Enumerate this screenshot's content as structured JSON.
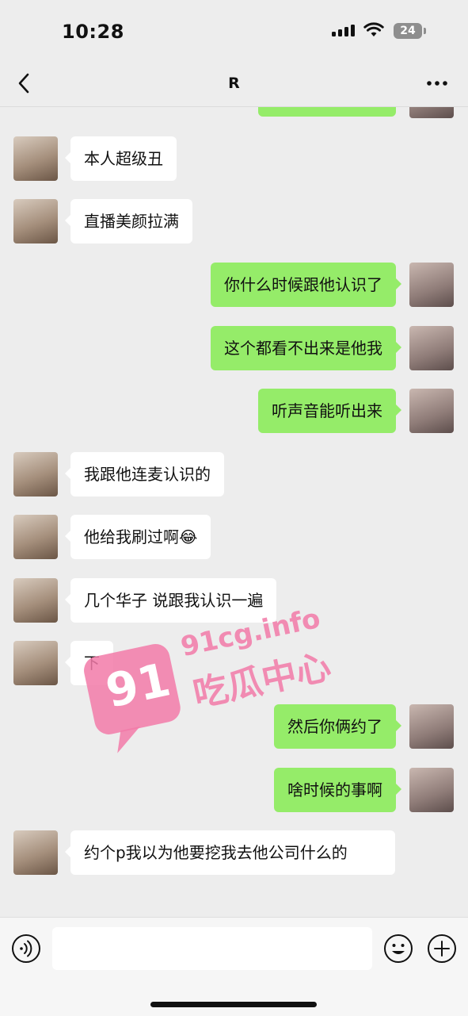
{
  "status_bar": {
    "time": "10:28",
    "battery": "24"
  },
  "header": {
    "title": "R"
  },
  "messages": [
    {
      "side": "in",
      "text": "本人超级丑"
    },
    {
      "side": "in",
      "text": "直播美颜拉满"
    },
    {
      "side": "out",
      "text": "你什么时候跟他认识了"
    },
    {
      "side": "out",
      "text": "这个都看不出来是他我"
    },
    {
      "side": "out",
      "text": "听声音能听出来"
    },
    {
      "side": "in",
      "text": "我跟他连麦认识的"
    },
    {
      "side": "in",
      "text": "他给我刷过啊",
      "emoji": "😂"
    },
    {
      "side": "in",
      "text": "几个华子 说跟我认识一遍"
    },
    {
      "side": "in",
      "text": "下"
    },
    {
      "side": "out",
      "text": "然后你俩约了"
    },
    {
      "side": "out",
      "text": "啥时候的事啊"
    },
    {
      "side": "in",
      "text": "约个p我以为他要挖我去他公司什么的"
    }
  ],
  "watermark": {
    "number": "91",
    "domain": "91cg.info",
    "name": "吃瓜中心"
  },
  "input_bar": {
    "text_value": ""
  },
  "icons": {
    "back": "chevron-left-icon",
    "more": "more-dots-icon",
    "voice": "voice-icon",
    "emoji": "smiley-icon",
    "plus": "plus-icon"
  },
  "colors": {
    "background": "#ededed",
    "outgoing_bubble": "#95ec69",
    "incoming_bubble": "#ffffff",
    "watermark": "#f27aa8"
  }
}
